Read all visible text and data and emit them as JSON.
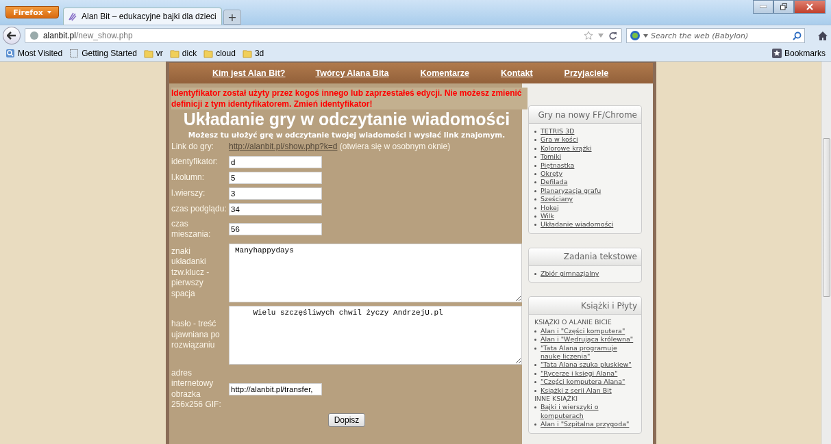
{
  "browser": {
    "menu_button": "Firefox",
    "tab": {
      "title": "Alan Bit – edukacyjne bajki dla dzieci",
      "selected": true
    },
    "new_tab": "+",
    "url_host": "alanbit.pl",
    "url_path": "/new_show.php",
    "search_placeholder": "Search the web (Babylon)",
    "bookmarks": [
      {
        "label": "Most Visited",
        "kind": "smart"
      },
      {
        "label": "Getting Started",
        "kind": "page"
      },
      {
        "label": "vr",
        "kind": "folder"
      },
      {
        "label": "dick",
        "kind": "folder"
      },
      {
        "label": "cloud",
        "kind": "folder"
      },
      {
        "label": "3d",
        "kind": "folder"
      }
    ],
    "bookmarks_menu": "Bookmarks"
  },
  "site": {
    "nav": [
      "Kim jest Alan Bit?",
      "Twórcy Alana Bita",
      "Komentarze",
      "Kontakt",
      "Przyjaciele"
    ],
    "error": "Identyfikator został użyty przez kogoś innego lub zaprzestałeś edycji. Nie możesz zmienić definicji z tym identyfikatorem. Zmień identyfikator!",
    "title": "Układanie gry w odczytanie wiadomości",
    "subtitle": "Możesz tu ułożyć grę w odczytanie twojej wiadomości i wysłać link znajomym.",
    "link_label": "Link do gry:",
    "link_url": "http://alanbit.pl/show.php?k=d",
    "link_note": "(otwiera się w osobnym oknie)",
    "fields": [
      {
        "label": "identyfikator:",
        "value": "d",
        "kind": "input"
      },
      {
        "label": "l.kolumn:",
        "value": "5",
        "kind": "input"
      },
      {
        "label": "l.wierszy:",
        "value": "3",
        "kind": "input"
      },
      {
        "label": "czas podglądu:",
        "value": "34",
        "kind": "input"
      },
      {
        "label": "czas mieszania:",
        "value": "56",
        "kind": "input"
      },
      {
        "label": "znaki układanki tzw.klucz - pierwszy spacja",
        "value": "Manyhappydays",
        "kind": "textarea"
      },
      {
        "label": "hasło - treść ujawniana po rozwiązaniu",
        "value": "    Wielu szczęśliwych chwil życzy AndrzejU.pl",
        "kind": "textarea"
      },
      {
        "label": "adres internetowy obrazka 256x256 GIF:",
        "value": "http://alanbit.pl/transfer,",
        "kind": "input"
      }
    ],
    "submit": "Dopisz",
    "sidebar": [
      {
        "title": "Gry na nowy FF/Chrome",
        "items": [
          {
            "kind": "link",
            "label": "TETRIS 3D"
          },
          {
            "kind": "link",
            "label": "Gra w kości"
          },
          {
            "kind": "link",
            "label": "Kolorowe krążki"
          },
          {
            "kind": "link",
            "label": "Tomiki"
          },
          {
            "kind": "link",
            "label": "Piętnastka"
          },
          {
            "kind": "link",
            "label": "Okręty"
          },
          {
            "kind": "link",
            "label": "Defilada"
          },
          {
            "kind": "link",
            "label": "Planaryzacja grafu"
          },
          {
            "kind": "link",
            "label": "Sześciany"
          },
          {
            "kind": "link",
            "label": "Hokej"
          },
          {
            "kind": "link",
            "label": "Wilk"
          },
          {
            "kind": "link",
            "label": "Układanie wiadomości"
          }
        ]
      },
      {
        "title": "Zadania tekstowe",
        "items": [
          {
            "kind": "link",
            "label": "Zbiór gimnazjalny"
          }
        ]
      },
      {
        "title": "Książki i Płyty",
        "items": [
          {
            "kind": "heading",
            "label": "KSIĄŻKI O ALANIE BICIE"
          },
          {
            "kind": "link",
            "label": "Alan i \"Części komputera\""
          },
          {
            "kind": "link",
            "label": "Alan i \"Wędrująca królewna\""
          },
          {
            "kind": "link",
            "label": "\"Tata Alana programuje naukę liczenia\""
          },
          {
            "kind": "link",
            "label": "\"Tata Alana szuka pluskiew\""
          },
          {
            "kind": "link",
            "label": "\"Rycerze i księgi Alana\""
          },
          {
            "kind": "link",
            "label": "\"Części komputera Alana\""
          },
          {
            "kind": "link",
            "label": "Książki z serii Alan Bit"
          },
          {
            "kind": "heading",
            "label": "INNE KSIĄŻKI"
          },
          {
            "kind": "link",
            "label": "Bajki i wierszyki o komputerach"
          },
          {
            "kind": "link",
            "label": "Alan i \"Szpitalna przygoda\""
          }
        ]
      }
    ]
  }
}
